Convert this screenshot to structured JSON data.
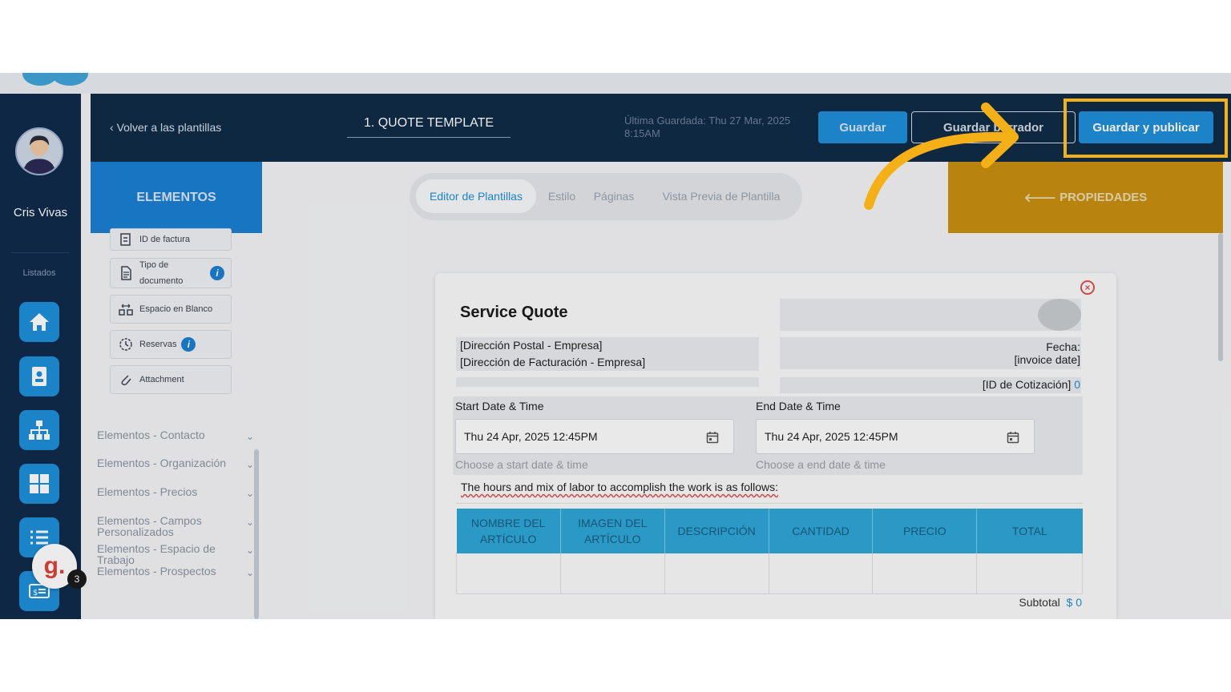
{
  "user": {
    "name": "Cris Vivas"
  },
  "rail": {
    "section": "Listados",
    "help_badge_letter": "g.",
    "help_count": "3"
  },
  "topbar": {
    "back": "Volver a las plantillas",
    "title": "1. QUOTE TEMPLATE",
    "last_saved": "Última Guardada: Thu 27 Mar, 2025 8:15AM",
    "save": "Guardar",
    "draft": "Guardar borrador",
    "publish": "Guardar y publicar"
  },
  "elements": {
    "header": "ELEMENTOS",
    "cards": [
      {
        "label": "ID de factura"
      },
      {
        "label": "Tipo de documento"
      },
      {
        "label": "Espacio en Blanco"
      },
      {
        "label": "Reservas"
      },
      {
        "label": "Attachment"
      }
    ],
    "groups": [
      "Elementos - Contacto",
      "Elementos - Organización",
      "Elementos - Precios",
      "Elementos - Campos Personalizados",
      "Elementos - Espacio de Trabajo",
      "Elementos - Prospectos"
    ]
  },
  "tabs": [
    "Editor de Plantillas",
    "Estilo",
    "Páginas",
    "Vista Previa de Plantilla"
  ],
  "properties": {
    "label": "PROPIEDADES"
  },
  "doc": {
    "title": "Service Quote",
    "address1": "[Dirección Postal - Empresa]",
    "address2": "[Dirección de Facturación - Empresa]",
    "fecha_label": "Fecha:",
    "fecha_value": "[invoice date]",
    "quote_id_label": "[ID de Cotización]",
    "quote_id_value": "0",
    "start_label": "Start Date & Time",
    "start_value": "Thu 24 Apr, 2025 12:45PM",
    "start_hint": "Choose a start date & time",
    "end_label": "End Date & Time",
    "end_value": "Thu 24 Apr, 2025 12:45PM",
    "end_hint": "Choose a end date & time",
    "intro": "The hours and mix of labor to accomplish the work is as follows:",
    "columns": [
      "NOMBRE DEL ARTÍCULO",
      "IMAGEN DEL ARTÍCULO",
      "DESCRIPCIÓN",
      "CANTIDAD",
      "PRECIO",
      "TOTAL"
    ],
    "subtotal_label": "Subtotal",
    "subtotal_value": "$ 0"
  },
  "colors": {
    "accent": "#1f8fd9",
    "highlight": "#f6b017",
    "navy": "#102c48",
    "properties": "#c8900f"
  }
}
